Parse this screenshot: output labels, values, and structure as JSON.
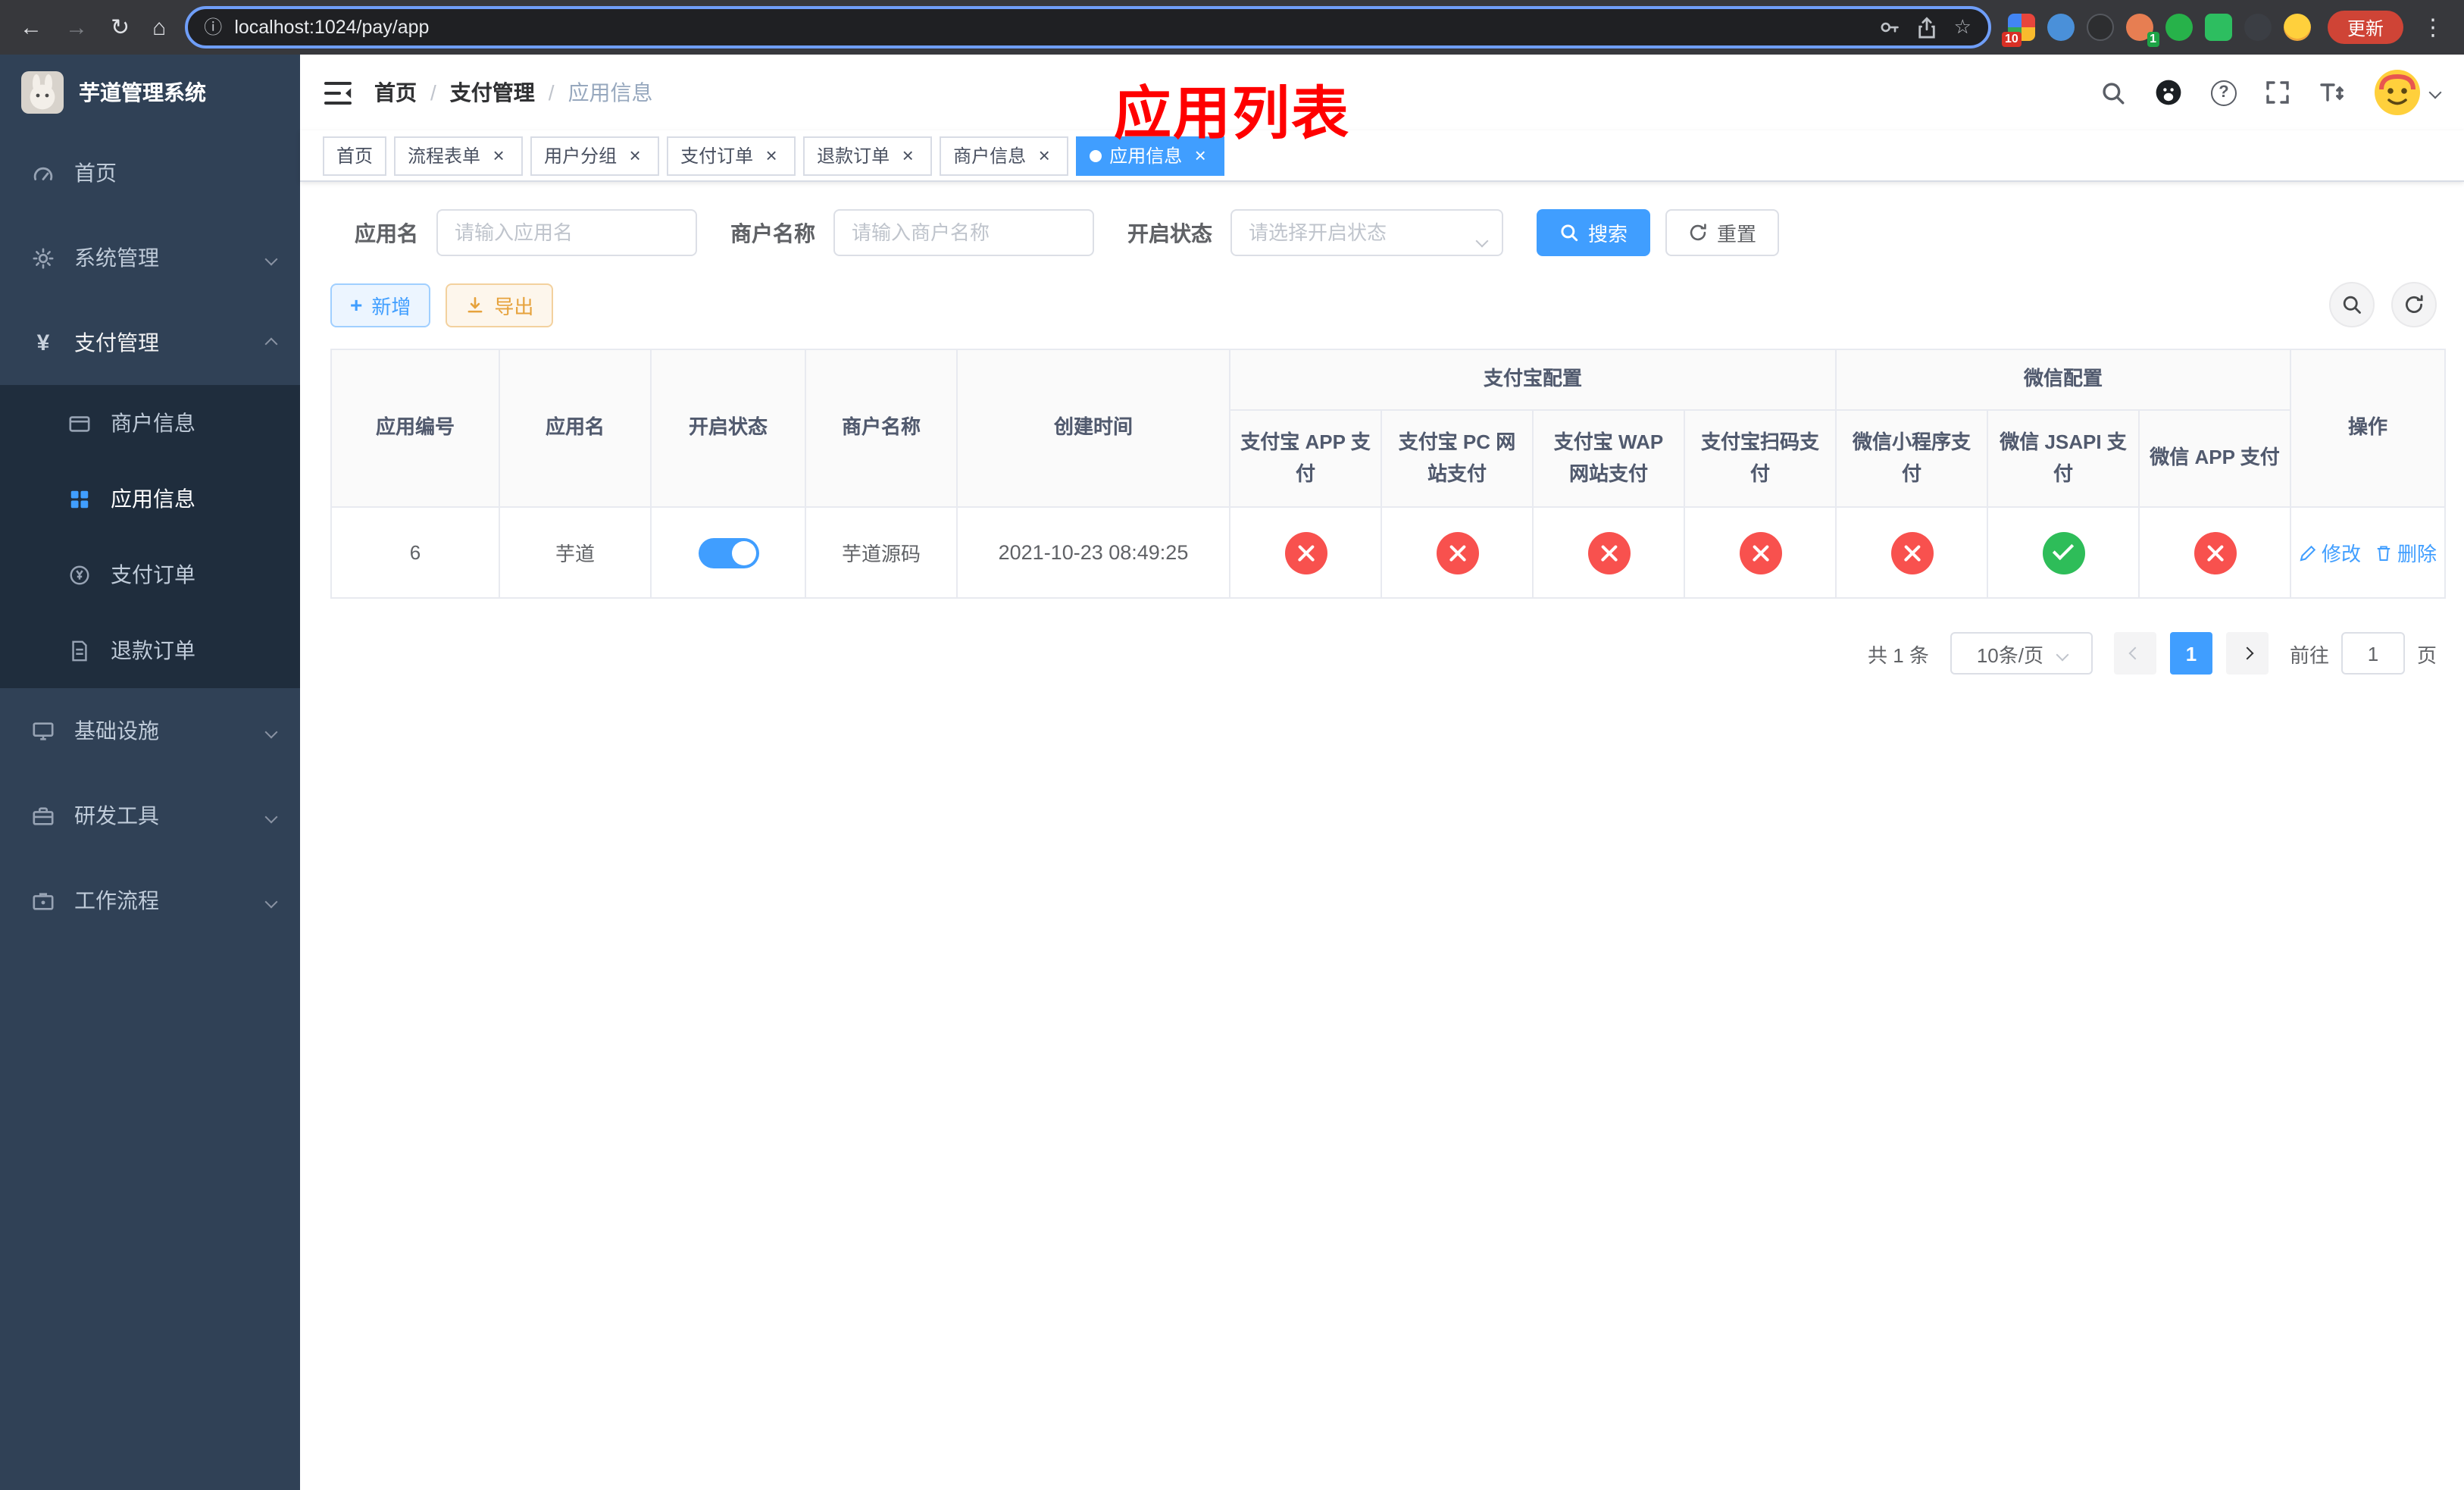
{
  "browser": {
    "url": "localhost:1024/pay/app",
    "update_label": "更新",
    "ext_badge_red": "10",
    "ext_badge_green": "1"
  },
  "sidebar": {
    "app_title": "芋道管理系统",
    "items": {
      "home": "首页",
      "system": "系统管理",
      "payment": "支付管理",
      "infra": "基础设施",
      "devtools": "研发工具",
      "workflow": "工作流程"
    },
    "payment_children": {
      "merchant": "商户信息",
      "app": "应用信息",
      "pay_order": "支付订单",
      "refund_order": "退款订单"
    }
  },
  "navbar": {
    "breadcrumb": [
      "首页",
      "支付管理",
      "应用信息"
    ]
  },
  "annotation": "应用列表",
  "tabs": [
    {
      "label": "首页",
      "closable": false,
      "active": false
    },
    {
      "label": "流程表单",
      "closable": true,
      "active": false
    },
    {
      "label": "用户分组",
      "closable": true,
      "active": false
    },
    {
      "label": "支付订单",
      "closable": true,
      "active": false
    },
    {
      "label": "退款订单",
      "closable": true,
      "active": false
    },
    {
      "label": "商户信息",
      "closable": true,
      "active": false
    },
    {
      "label": "应用信息",
      "closable": true,
      "active": true
    }
  ],
  "filters": {
    "app_name_label": "应用名",
    "app_name_placeholder": "请输入应用名",
    "merchant_label": "商户名称",
    "merchant_placeholder": "请输入商户名称",
    "status_label": "开启状态",
    "status_placeholder": "请选择开启状态",
    "search_label": "搜索",
    "reset_label": "重置"
  },
  "toolbar": {
    "add_label": "新增",
    "export_label": "导出"
  },
  "table": {
    "groups": {
      "alipay": "支付宝配置",
      "wechat": "微信配置"
    },
    "columns": [
      "应用编号",
      "应用名",
      "开启状态",
      "商户名称",
      "创建时间",
      "支付宝 APP 支付",
      "支付宝 PC 网站支付",
      "支付宝 WAP 网站支付",
      "支付宝扫码支付",
      "微信小程序支付",
      "微信 JSAPI 支付",
      "微信 APP 支付",
      "操作"
    ],
    "actions": {
      "edit": "修改",
      "delete": "删除"
    },
    "rows": [
      {
        "app_id": "6",
        "app_name": "芋道",
        "enabled": true,
        "merchant_name": "芋道源码",
        "create_time": "2021-10-23 08:49:25",
        "config_status": {
          "alipay_app": false,
          "alipay_pc": false,
          "alipay_wap": false,
          "alipay_qr": false,
          "wechat_mini": false,
          "wechat_jsapi": true,
          "wechat_app": false
        }
      }
    ]
  },
  "pagination": {
    "total": "共 1 条",
    "page_size": "10条/页",
    "current_page": "1",
    "goto_prefix": "前往",
    "goto_value": "1",
    "goto_suffix": "页"
  },
  "colors": {
    "accent_blue": "#409eff",
    "success_green": "#2ebd59",
    "danger_red": "#f8514e",
    "warning_orange": "#e6a23c",
    "sidebar_bg": "#304156",
    "submenu_bg": "#1f2d3d",
    "active_tab_bg": "#409eff",
    "annotation_red": "#ff0000",
    "update_button_red": "#cf4436"
  },
  "icons": {
    "status_fail": "circle-x",
    "status_success": "circle-check",
    "search": "magnifier",
    "github": "github-mark",
    "help": "question-circle",
    "fullscreen": "expand-corners",
    "font_size": "text-size",
    "hamburger": "menu-fold",
    "refresh": "circular-arrow",
    "add": "plus",
    "export": "download-arrow",
    "edit": "pencil",
    "delete": "trash"
  }
}
